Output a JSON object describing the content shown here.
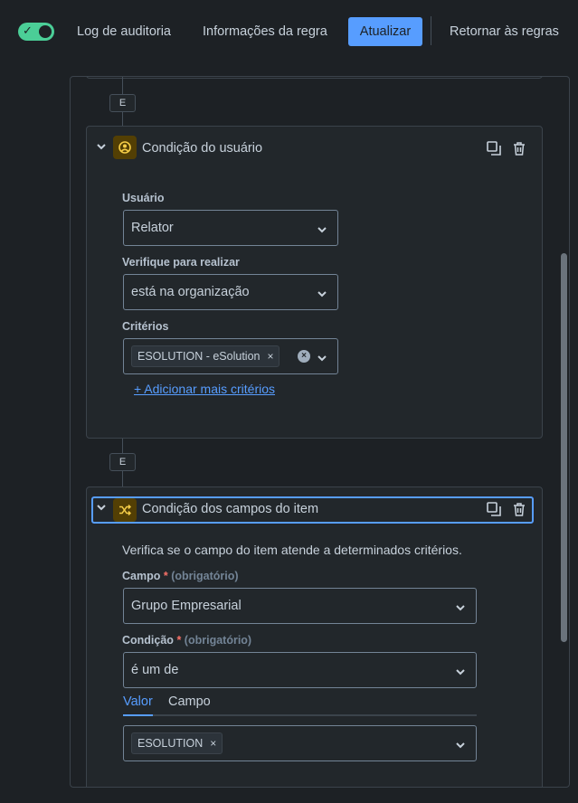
{
  "header": {
    "toggle_checked": true,
    "audit_log": "Log de auditoria",
    "rule_info": "Informações da regra",
    "update": "Atualizar",
    "back_to_rules": "Retornar às regras"
  },
  "connectors": {
    "and_label": "E"
  },
  "user_condition": {
    "title": "Condição do usuário",
    "user_label": "Usuário",
    "user_value": "Relator",
    "check_label": "Verifique para realizar",
    "check_value": "está na organização",
    "criteria_label": "Critérios",
    "criteria_tags": [
      "ESOLUTION - eSolution"
    ],
    "add_criteria": "+ Adicionar mais critérios"
  },
  "field_condition": {
    "title": "Condição dos campos do item",
    "description": "Verifica se o campo do item atende a determinados critérios.",
    "field_label": "Campo",
    "required_mark": "*",
    "required_hint": "(obrigatório)",
    "field_value": "Grupo Empresarial",
    "condition_label": "Condição",
    "condition_value": "é um de",
    "tabs": [
      {
        "label": "Valor",
        "active": true
      },
      {
        "label": "Campo",
        "active": false
      }
    ],
    "value_tags": [
      "ESOLUTION"
    ]
  },
  "colors": {
    "accent": "#579dff",
    "toggle": "#4bce97",
    "background": "#1d2125",
    "card": "#22272b",
    "required": "#f87168",
    "icon_bg": "#533f04",
    "icon_fg": "#f5cd47"
  }
}
